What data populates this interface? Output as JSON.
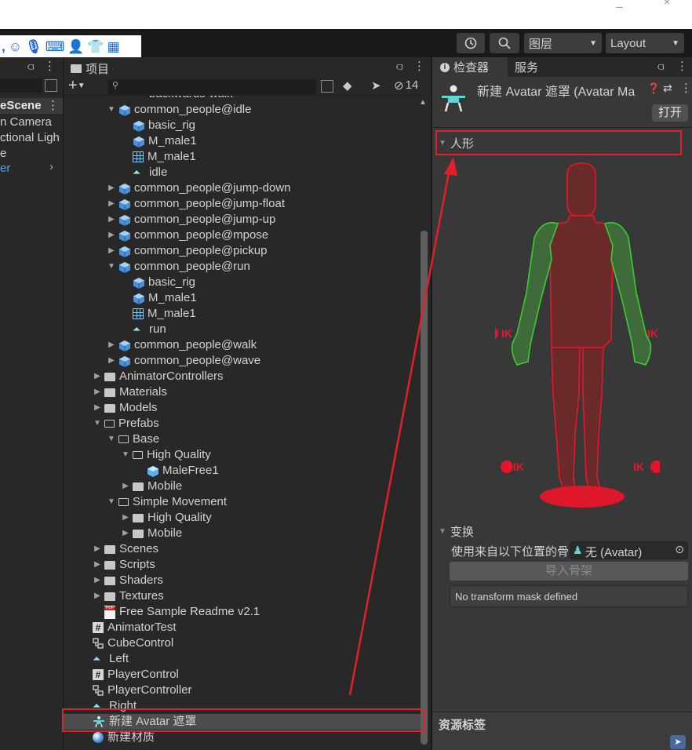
{
  "window": {
    "btn_minimize": "_",
    "btn_close": "×"
  },
  "toolbar": {
    "history_icon": "history-icon",
    "search_icon": "search-icon",
    "layers_label": "图层",
    "layout_label": "Layout"
  },
  "hierarchy": {
    "scene": "eScene",
    "items": [
      "n Camera",
      "ctional Ligh",
      "e",
      "er"
    ]
  },
  "project": {
    "tab": "项目",
    "add_label": "+",
    "search_placeholder": "",
    "hidden_count": "14",
    "rows": [
      {
        "label": "backwards-walk",
        "icon": "anim",
        "depth": 2,
        "arrow": ""
      },
      {
        "label": "common_people@idle",
        "icon": "model",
        "depth": 1,
        "arrow": "▼"
      },
      {
        "label": "basic_rig",
        "icon": "model",
        "depth": 2,
        "arrow": ""
      },
      {
        "label": "M_male1",
        "icon": "model",
        "depth": 2,
        "arrow": ""
      },
      {
        "label": "M_male1",
        "icon": "mesh",
        "depth": 2,
        "arrow": ""
      },
      {
        "label": "idle",
        "icon": "anim",
        "depth": 2,
        "arrow": ""
      },
      {
        "label": "common_people@jump-down",
        "icon": "model",
        "depth": 1,
        "arrow": "▶"
      },
      {
        "label": "common_people@jump-float",
        "icon": "model",
        "depth": 1,
        "arrow": "▶"
      },
      {
        "label": "common_people@jump-up",
        "icon": "model",
        "depth": 1,
        "arrow": "▶"
      },
      {
        "label": "common_people@mpose",
        "icon": "model",
        "depth": 1,
        "arrow": "▶"
      },
      {
        "label": "common_people@pickup",
        "icon": "model",
        "depth": 1,
        "arrow": "▶"
      },
      {
        "label": "common_people@run",
        "icon": "model",
        "depth": 1,
        "arrow": "▼"
      },
      {
        "label": "basic_rig",
        "icon": "model",
        "depth": 2,
        "arrow": ""
      },
      {
        "label": "M_male1",
        "icon": "model",
        "depth": 2,
        "arrow": ""
      },
      {
        "label": "M_male1",
        "icon": "mesh",
        "depth": 2,
        "arrow": ""
      },
      {
        "label": "run",
        "icon": "anim",
        "depth": 2,
        "arrow": ""
      },
      {
        "label": "common_people@walk",
        "icon": "model",
        "depth": 1,
        "arrow": "▶"
      },
      {
        "label": "common_people@wave",
        "icon": "model",
        "depth": 1,
        "arrow": "▶"
      },
      {
        "label": "AnimatorControllers",
        "icon": "folder",
        "depth": 0,
        "arrow": "▶"
      },
      {
        "label": "Materials",
        "icon": "folder",
        "depth": 0,
        "arrow": "▶"
      },
      {
        "label": "Models",
        "icon": "folder",
        "depth": 0,
        "arrow": "▶"
      },
      {
        "label": "Prefabs",
        "icon": "folder-open",
        "depth": 0,
        "arrow": "▼"
      },
      {
        "label": "Base",
        "icon": "folder-open",
        "depth": 1,
        "arrow": "▼"
      },
      {
        "label": "High Quality",
        "icon": "folder-open",
        "depth": 2,
        "arrow": "▼"
      },
      {
        "label": "MaleFree1",
        "icon": "prefab",
        "depth": 3,
        "arrow": ""
      },
      {
        "label": "Mobile",
        "icon": "folder",
        "depth": 2,
        "arrow": "▶"
      },
      {
        "label": "Simple Movement",
        "icon": "folder-open",
        "depth": 1,
        "arrow": "▼"
      },
      {
        "label": "High Quality",
        "icon": "folder",
        "depth": 2,
        "arrow": "▶"
      },
      {
        "label": "Mobile",
        "icon": "folder",
        "depth": 2,
        "arrow": "▶"
      },
      {
        "label": "Scenes",
        "icon": "folder",
        "depth": 0,
        "arrow": "▶"
      },
      {
        "label": "Scripts",
        "icon": "folder",
        "depth": 0,
        "arrow": "▶"
      },
      {
        "label": "Shaders",
        "icon": "folder",
        "depth": 0,
        "arrow": "▶"
      },
      {
        "label": "Textures",
        "icon": "folder",
        "depth": 0,
        "arrow": "▶"
      },
      {
        "label": "Free Sample Readme v2.1",
        "icon": "pdf",
        "depth": 0,
        "arrow": ""
      },
      {
        "label": "AnimatorTest",
        "icon": "script",
        "depth": -1,
        "arrow": ""
      },
      {
        "label": "CubeControl",
        "icon": "controller",
        "depth": -1,
        "arrow": ""
      },
      {
        "label": "Left",
        "icon": "anim",
        "depth": -1,
        "arrow": ""
      },
      {
        "label": "PlayerControl",
        "icon": "script",
        "depth": -1,
        "arrow": ""
      },
      {
        "label": "PlayerController",
        "icon": "controller",
        "depth": -1,
        "arrow": ""
      },
      {
        "label": "Right",
        "icon": "anim",
        "depth": -1,
        "arrow": ""
      },
      {
        "label": "新建 Avatar 遮罩",
        "icon": "avatar-mask",
        "depth": -1,
        "arrow": "",
        "selected": true
      },
      {
        "label": "新建材质",
        "icon": "material",
        "depth": -1,
        "arrow": ""
      }
    ]
  },
  "inspector": {
    "tab_inspector": "检查器",
    "tab_services": "服务",
    "title": "新建 Avatar 遮罩 (Avatar Ma",
    "open_button": "打开",
    "humanoid_label": "人形",
    "ik": "IK",
    "transform_label": "变换",
    "use_skeleton_label": "使用来自以下位置的骨",
    "avatar_field": "无 (Avatar)",
    "import_skeleton_button": "导入骨架",
    "no_mask_msg": "No transform mask defined",
    "asset_labels": "资源标签"
  },
  "colors": {
    "accent_red": "#e0202a",
    "enabled_green": "#3ccd32",
    "disabled_red": "#e8152a"
  }
}
